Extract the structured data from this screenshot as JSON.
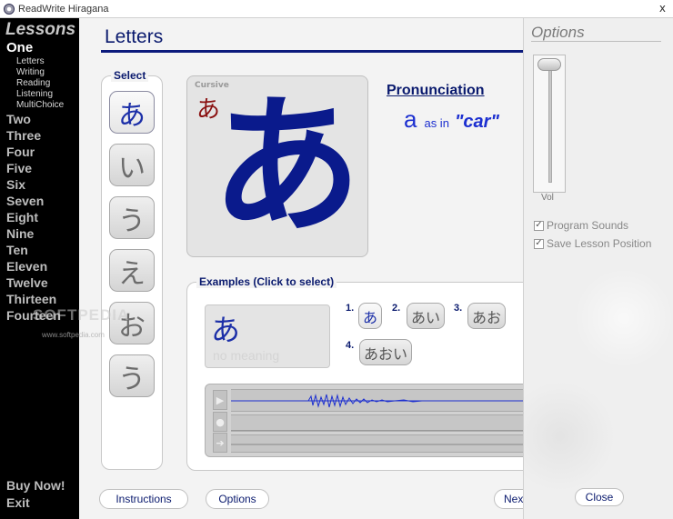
{
  "window": {
    "title": "ReadWrite Hiragana",
    "close_glyph": "x"
  },
  "lessons": {
    "heading": "Lessons",
    "items": [
      "One",
      "Two",
      "Three",
      "Four",
      "Five",
      "Six",
      "Seven",
      "Eight",
      "Nine",
      "Ten",
      "Eleven",
      "Twelve",
      "Thirteen",
      "Fourteen"
    ],
    "sub_items": [
      "Letters",
      "Writing",
      "Reading",
      "Listening",
      "MultiChoice"
    ],
    "buy_now": "Buy Now!",
    "exit": "Exit"
  },
  "watermark": {
    "text": "SOFTPEDIA",
    "url": "www.softpedia.com"
  },
  "main": {
    "title": "Letters",
    "select_label": "Select",
    "kana_buttons": [
      "あ",
      "い",
      "う",
      "え",
      "お",
      "う"
    ],
    "cursive_label": "Cursive",
    "cursive_char": "あ",
    "big_char": "あ",
    "pronunciation": {
      "label": "Pronunciation",
      "romaji": "a",
      "as_in": "as in",
      "word": "\"car\""
    },
    "examples": {
      "label": "Examples (Click to select)",
      "current_kana": "あ",
      "current_meaning": "no meaning",
      "items": [
        {
          "num": "1.",
          "kana": "あ"
        },
        {
          "num": "2.",
          "kana": "あい"
        },
        {
          "num": "3.",
          "kana": "あお"
        },
        {
          "num": "4.",
          "kana": "あおい"
        }
      ]
    },
    "buttons": {
      "instructions": "Instructions",
      "options": "Options",
      "next": "Next"
    }
  },
  "options": {
    "heading": "Options",
    "volume_label": "Vol",
    "volume_level": 1.0,
    "program_sounds": {
      "label": "Program Sounds",
      "checked": true
    },
    "save_position": {
      "label": "Save Lesson Position",
      "checked": true
    },
    "close": "Close"
  },
  "colors": {
    "accent": "#0a1a6e",
    "kana_blue": "#0a1a8c",
    "cursive_red": "#8a1010",
    "waveform": "#1c2fd0"
  }
}
